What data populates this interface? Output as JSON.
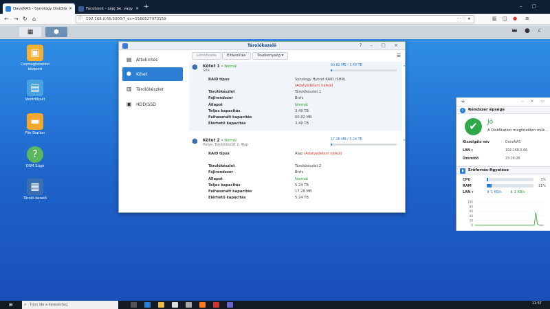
{
  "browser": {
    "tabs": [
      {
        "label": "DaveNAS - Synology DiskStati",
        "favicon_color": "#2d7fd6"
      },
      {
        "label": "Facebook - Lépj be, vagy regis",
        "favicon_color": "#3b5998"
      }
    ],
    "url": "192.168.0.66:5000/?_dc=1560527972159",
    "new_tab_label": "+"
  },
  "storage_manager": {
    "title": "Tárolókezelő",
    "sidebar": [
      {
        "label": "Áttekintés",
        "icon": "overview-icon"
      },
      {
        "label": "Kötet",
        "icon": "volume-icon",
        "active": true
      },
      {
        "label": "Tárolókészlet",
        "icon": "storage-pool-icon"
      },
      {
        "label": "HDD/SSD",
        "icon": "hdd-icon"
      }
    ],
    "toolbar": {
      "create": "Létrehozás",
      "remove": "Eltávolítás",
      "action": "Tevékenység ▾"
    },
    "volumes": [
      {
        "name": "Kötet 1",
        "status": "Normál",
        "subtitle": "SHR",
        "usage_text": "60.82 MB / 3.49 TB",
        "usage_fraction": 0.02,
        "props": [
          {
            "k": "RAID típus",
            "v": "Synology Hybrid RAID (SHR) ",
            "warn": "(Adatvédelem nélkül)"
          },
          {
            "k": "Tárolókészlet",
            "v": "Tárolókészlet 1"
          },
          {
            "k": "Fájlrendszer",
            "v": "Btrfs"
          },
          {
            "k": "Állapot",
            "v": "Normál",
            "ok": true
          },
          {
            "k": "Teljes kapacitás",
            "v": "3.49 TB"
          },
          {
            "k": "Felhasznált kapacitás",
            "v": "60.82 MB"
          },
          {
            "k": "Elérhető kapacitás",
            "v": "3.49 TB"
          }
        ]
      },
      {
        "name": "Kötet 2",
        "status": "Normál",
        "subtitle": "Helye: Tárolókészlet 2, Alap",
        "usage_text": "17.28 MB / 5.24 TB",
        "usage_fraction": 0.01,
        "props": [
          {
            "k": "RAID típus",
            "v": "Alap ",
            "warn": "(Adatvédelem nélkül)"
          },
          {
            "k": "Tárolókészlet",
            "v": "Tárolókészlet 2"
          },
          {
            "k": "Fájlrendszer",
            "v": "Btrfs"
          },
          {
            "k": "Állapot",
            "v": "Normál",
            "ok": true
          },
          {
            "k": "Teljes kapacitás",
            "v": "5.24 TB"
          },
          {
            "k": "Felhasznált kapacitás",
            "v": "17.28 MB"
          },
          {
            "k": "Elérhető kapacitás",
            "v": "5.24 TB"
          }
        ]
      }
    ]
  },
  "desktop_icons": [
    {
      "label": "Csomagkezelési központ",
      "color": "#f2b134",
      "glyph": "▣"
    },
    {
      "label": "Vezérlőpult",
      "color": "#4aa3df",
      "glyph": "▤"
    },
    {
      "label": "File Station",
      "color": "#f0a830",
      "glyph": "▬"
    },
    {
      "label": "DSM Súgó",
      "color": "#5cb85c",
      "glyph": "?"
    },
    {
      "label": "Tároló-kezelő",
      "color": "#3c6fb0",
      "glyph": "▦"
    }
  ],
  "widgets": {
    "health": {
      "title": "Rendszer épsége",
      "status": "Jó",
      "message": "A DiskStation megfelelően műk..."
    },
    "info": [
      {
        "k": "Kiszolgáló név",
        "v": "DaveNAS"
      },
      {
        "k": "LAN ▾",
        "v": "192.168.0.66"
      },
      {
        "k": "Üzemidő",
        "v": "23:26:26"
      }
    ],
    "resource": {
      "title": "Erőforrás-figyelése",
      "cpu_label": "CPU",
      "cpu_pct": "3%",
      "cpu_value": 3,
      "ram_label": "RAM",
      "ram_pct": "11%",
      "ram_value": 11,
      "lan_label": "LAN ▾",
      "lan_up": "1 KB/s",
      "lan_down": "1 KB/s"
    }
  },
  "chart_data": {
    "type": "line",
    "title": "",
    "y_ticks": [
      "100",
      "80",
      "60",
      "40",
      "20",
      "0"
    ],
    "ylim": [
      0,
      100
    ],
    "series": [
      {
        "values": [
          0,
          0,
          0,
          0,
          0,
          0,
          0,
          0,
          0,
          0,
          0,
          0,
          0,
          0,
          0,
          0,
          0,
          0,
          0,
          0,
          0,
          0,
          0,
          0,
          0,
          0,
          0,
          0,
          0,
          0,
          0,
          0,
          0,
          0,
          0,
          0,
          0,
          0,
          55,
          5,
          0,
          0,
          0,
          0
        ]
      }
    ]
  },
  "taskbar": {
    "search_placeholder": "Írjon ide a kereséshez",
    "time": "11:37"
  }
}
